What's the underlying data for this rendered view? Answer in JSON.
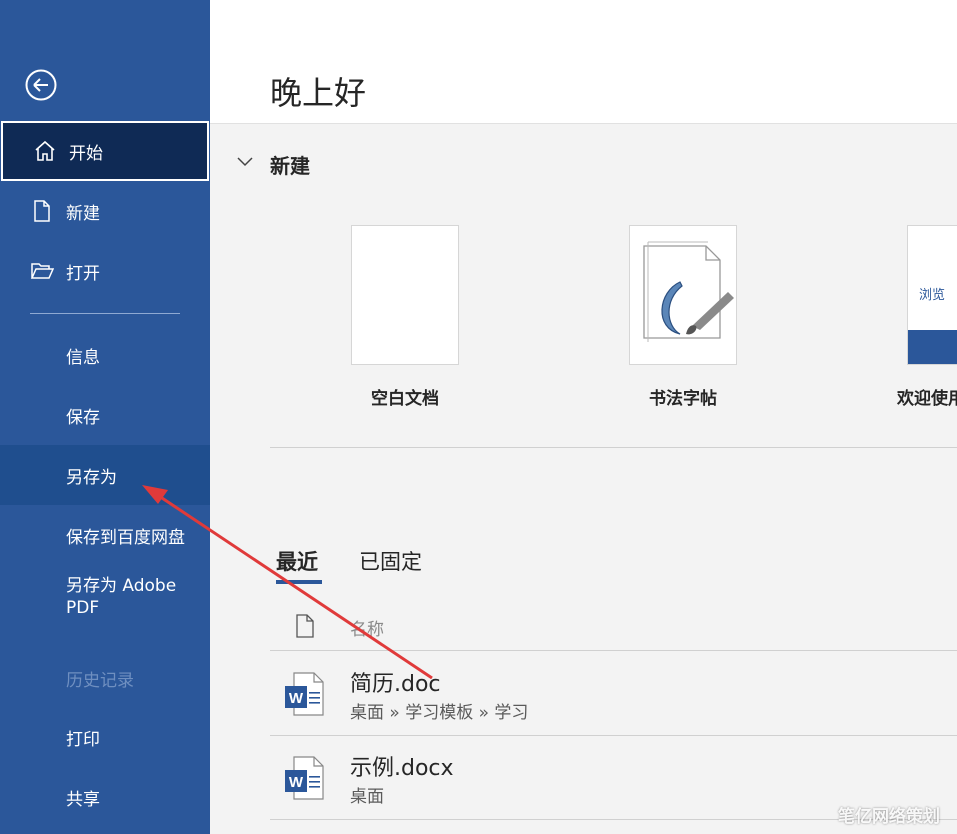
{
  "sidebar": {
    "items": [
      {
        "label": "开始",
        "icon": "home-icon"
      },
      {
        "label": "新建",
        "icon": "new-document-icon"
      },
      {
        "label": "打开",
        "icon": "folder-open-icon"
      },
      {
        "label": "信息"
      },
      {
        "label": "保存"
      },
      {
        "label": "另存为"
      },
      {
        "label": "保存到百度网盘"
      },
      {
        "label": "另存为 Adobe PDF"
      },
      {
        "label": "历史记录"
      },
      {
        "label": "打印"
      },
      {
        "label": "共享"
      }
    ]
  },
  "header": {
    "greeting": "晚上好"
  },
  "new_section": {
    "title": "新建",
    "templates": [
      {
        "label": "空白文档"
      },
      {
        "label": "书法字帖"
      },
      {
        "label": "欢迎使用",
        "thumb_text": "浏览"
      }
    ]
  },
  "recent": {
    "tabs": [
      {
        "label": "最近"
      },
      {
        "label": "已固定"
      }
    ],
    "column_header": "名称",
    "files": [
      {
        "name": "简历.doc",
        "path": "桌面 » 学习模板 » 学习"
      },
      {
        "name": "示例.docx",
        "path": "桌面"
      }
    ]
  },
  "watermark": "笔亿网络策划",
  "colors": {
    "sidebar": "#2b579a",
    "selected": "#0f2a55",
    "accent": "#2b579a",
    "arrow": "#e03a3a"
  }
}
